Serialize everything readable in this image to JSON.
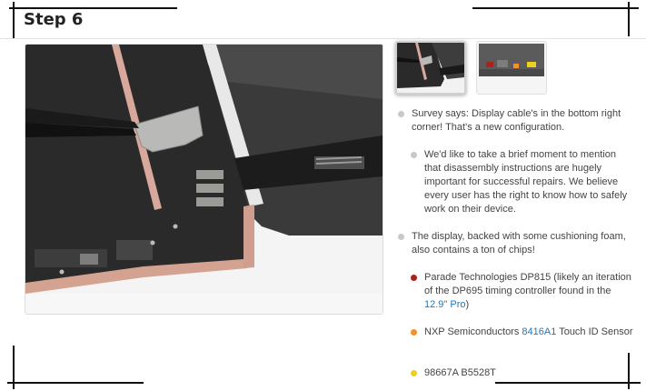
{
  "step": {
    "title": "Step 6"
  },
  "bullets": [
    {
      "level": 0,
      "color": "#c8c8c8",
      "text": "Survey says: Display cable's in the bottom right corner! That's a new configuration."
    },
    {
      "level": 1,
      "color": "#c8c8c8",
      "text": "We'd like to take a brief moment to mention that disassembly instructions are hugely important for successful repairs. We believe every user has the right to know how to safely work on their device."
    },
    {
      "level": 0,
      "color": "#c8c8c8",
      "text": "The display, backed with some cushioning foam, also contains a ton of chips!"
    },
    {
      "level": 1,
      "color": "#a8231e",
      "pre": "Parade Technologies DP815 (likely an iteration of the DP695 timing controller found in the ",
      "link": "12.9\" Pro",
      "post": ")"
    },
    {
      "level": 1,
      "color": "#f0922e",
      "pre": "NXP Semiconductors ",
      "link": "8416A1",
      "post": " Touch ID Sensor"
    },
    {
      "level": 1,
      "color": "#ecd11c",
      "text": "98667A B5528T"
    }
  ],
  "images": {
    "main_alt": "iPad display cable connector being removed with tweezers",
    "thumbnails": [
      "step-image-1",
      "step-image-2"
    ]
  }
}
